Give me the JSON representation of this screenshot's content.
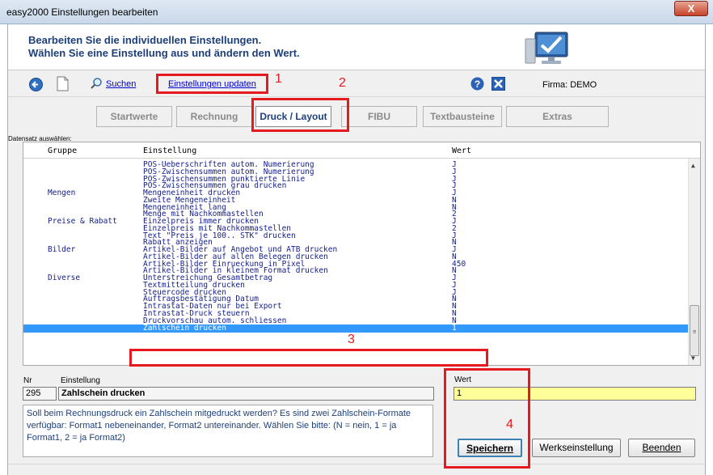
{
  "window": {
    "title": "easy2000 Einstellungen bearbeiten",
    "close_label": "X"
  },
  "header": {
    "line1": "Bearbeiten Sie die individuellen Einstellungen.",
    "line2": "Wählen Sie eine Einstellung aus und ändern den Wert."
  },
  "toolbar": {
    "search_label": "Suchen",
    "update_label": "Einstellungen updaten",
    "firma_label": "Firma:",
    "firma_value": "DEMO"
  },
  "annotations": [
    "1",
    "2",
    "3",
    "4"
  ],
  "tabs": [
    {
      "label": "Startwerte",
      "active": false
    },
    {
      "label": "Rechnung",
      "active": false
    },
    {
      "label": "Druck / Layout",
      "active": true
    },
    {
      "label": "FIBU",
      "active": false
    },
    {
      "label": "Textbausteine",
      "active": false
    },
    {
      "label": "Extras",
      "active": false
    }
  ],
  "grid": {
    "caption": "Datensatz auswählen:",
    "columns": [
      "Gruppe",
      "Einstellung",
      "Wert"
    ],
    "rows": [
      {
        "gruppe": "",
        "einstellung": "POS-Ueberschriften autom. Numerierung",
        "wert": "J"
      },
      {
        "gruppe": "",
        "einstellung": "POS-Zwischensummen autom. Numerierung",
        "wert": "J"
      },
      {
        "gruppe": "",
        "einstellung": "POS-Zwischensummen punktierte Linie",
        "wert": "J"
      },
      {
        "gruppe": "",
        "einstellung": "POS-Zwischensummen grau drucken",
        "wert": "J"
      },
      {
        "gruppe": "Mengen",
        "einstellung": "Mengeneinheit drucken",
        "wert": "J"
      },
      {
        "gruppe": "",
        "einstellung": "Zweite Mengeneinheit",
        "wert": "N"
      },
      {
        "gruppe": "",
        "einstellung": "Mengeneinheit lang",
        "wert": "N"
      },
      {
        "gruppe": "",
        "einstellung": "Menge mit Nachkommastellen",
        "wert": "2"
      },
      {
        "gruppe": "Preise & Rabatt",
        "einstellung": "Einzelpreis immer drucken",
        "wert": "J"
      },
      {
        "gruppe": "",
        "einstellung": "Einzelpreis mit Nachkommastellen",
        "wert": "2"
      },
      {
        "gruppe": "",
        "einstellung": "Text \"Preis je 100.. STK\" drucken",
        "wert": "J"
      },
      {
        "gruppe": "",
        "einstellung": "Rabatt anzeigen",
        "wert": "N"
      },
      {
        "gruppe": "Bilder",
        "einstellung": "Artikel-Bilder auf Angebot und ATB drucken",
        "wert": "J"
      },
      {
        "gruppe": "",
        "einstellung": "Artikel-Bilder auf allen Belegen drucken",
        "wert": "N"
      },
      {
        "gruppe": "",
        "einstellung": "Artikel-Bilder Einrueckung in Pixel",
        "wert": "450"
      },
      {
        "gruppe": "",
        "einstellung": "Artikel-Bilder in kleinem Format drucken",
        "wert": "N"
      },
      {
        "gruppe": "Diverse",
        "einstellung": "Unterstreichung Gesamtbetrag",
        "wert": "J"
      },
      {
        "gruppe": "",
        "einstellung": "Textmitteilung drucken",
        "wert": "J"
      },
      {
        "gruppe": "",
        "einstellung": "Steuercode drucken",
        "wert": "J"
      },
      {
        "gruppe": "",
        "einstellung": "Auftragsbestätigung Datum",
        "wert": "N"
      },
      {
        "gruppe": "",
        "einstellung": "Intrastat-Daten nur bei Export",
        "wert": "N"
      },
      {
        "gruppe": "",
        "einstellung": "Intrastat-Druck steuern",
        "wert": "N"
      },
      {
        "gruppe": "",
        "einstellung": "Druckvorschau autom. schliessen",
        "wert": "N"
      },
      {
        "gruppe": "",
        "einstellung": "Zahlschein drucken",
        "wert": "1",
        "selected": true
      }
    ]
  },
  "detail": {
    "nr_label": "Nr",
    "nr_value": "295",
    "einstellung_label": "Einstellung",
    "einstellung_value": "Zahlschein drucken",
    "wert_label": "Wert",
    "wert_value": "1",
    "description": "Soll beim Rechnungsdruck ein Zahlschein mitgedruckt werden? Es sind zwei Zahlschein-Formate verfügbar: Format1 nebeneinander, Format2 untereinander. Wählen Sie bitte: (N = nein, 1 = ja Format1,  2 = ja Format2)"
  },
  "buttons": {
    "save": "Speichern",
    "default": "Werkseinstellung",
    "close": "Beenden"
  },
  "colors": {
    "accent_red": "#e5191f",
    "selection": "#3399ff",
    "heading": "#1d3f7a",
    "wert_bg": "#ffff99"
  }
}
